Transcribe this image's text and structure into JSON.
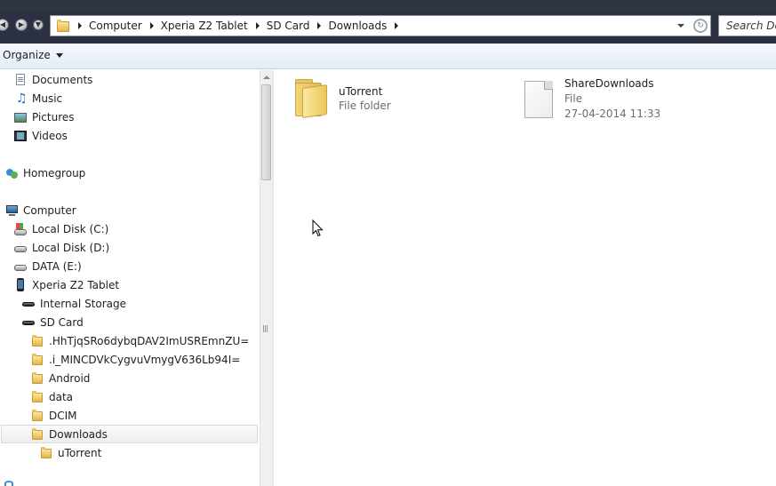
{
  "address": {
    "crumbs": [
      "Computer",
      "Xperia Z2 Tablet",
      "SD Card",
      "Downloads"
    ],
    "search_placeholder": "Search Downloads"
  },
  "toolbar": {
    "organize_label": "Organize"
  },
  "nav": {
    "items": [
      {
        "label": "Documents",
        "icon": "documents-icon"
      },
      {
        "label": "Music",
        "icon": "music-icon"
      },
      {
        "label": "Pictures",
        "icon": "pictures-icon"
      },
      {
        "label": "Videos",
        "icon": "videos-icon"
      },
      {
        "label": "Homegroup",
        "icon": "homegroup-icon"
      },
      {
        "label": "Computer",
        "icon": "computer-icon"
      },
      {
        "label": "Local Disk (C:)",
        "icon": "system-drive-icon"
      },
      {
        "label": "Local Disk (D:)",
        "icon": "drive-icon"
      },
      {
        "label": "DATA (E:)",
        "icon": "drive-icon"
      },
      {
        "label": "Xperia Z2 Tablet",
        "icon": "phone-icon"
      },
      {
        "label": "Internal Storage",
        "icon": "storage-icon"
      },
      {
        "label": "SD Card",
        "icon": "storage-icon"
      },
      {
        "label": ".HhTjqSRo6dybqDAV2ImUSREmnZU=",
        "icon": "folder-icon"
      },
      {
        "label": ".i_MINCDVkCygvuVmygV636Lb94I=",
        "icon": "folder-icon"
      },
      {
        "label": "Android",
        "icon": "folder-icon"
      },
      {
        "label": "data",
        "icon": "folder-icon"
      },
      {
        "label": "DCIM",
        "icon": "folder-icon"
      },
      {
        "label": "Downloads",
        "icon": "folder-icon",
        "selected": true
      },
      {
        "label": "uTorrent",
        "icon": "folder-icon"
      }
    ]
  },
  "files": [
    {
      "name": "uTorrent",
      "type": "File folder",
      "icon": "folder-large-icon"
    },
    {
      "name": "ShareDownloads",
      "type": "File",
      "date": "27-04-2014 11:33",
      "icon": "file-icon"
    }
  ]
}
